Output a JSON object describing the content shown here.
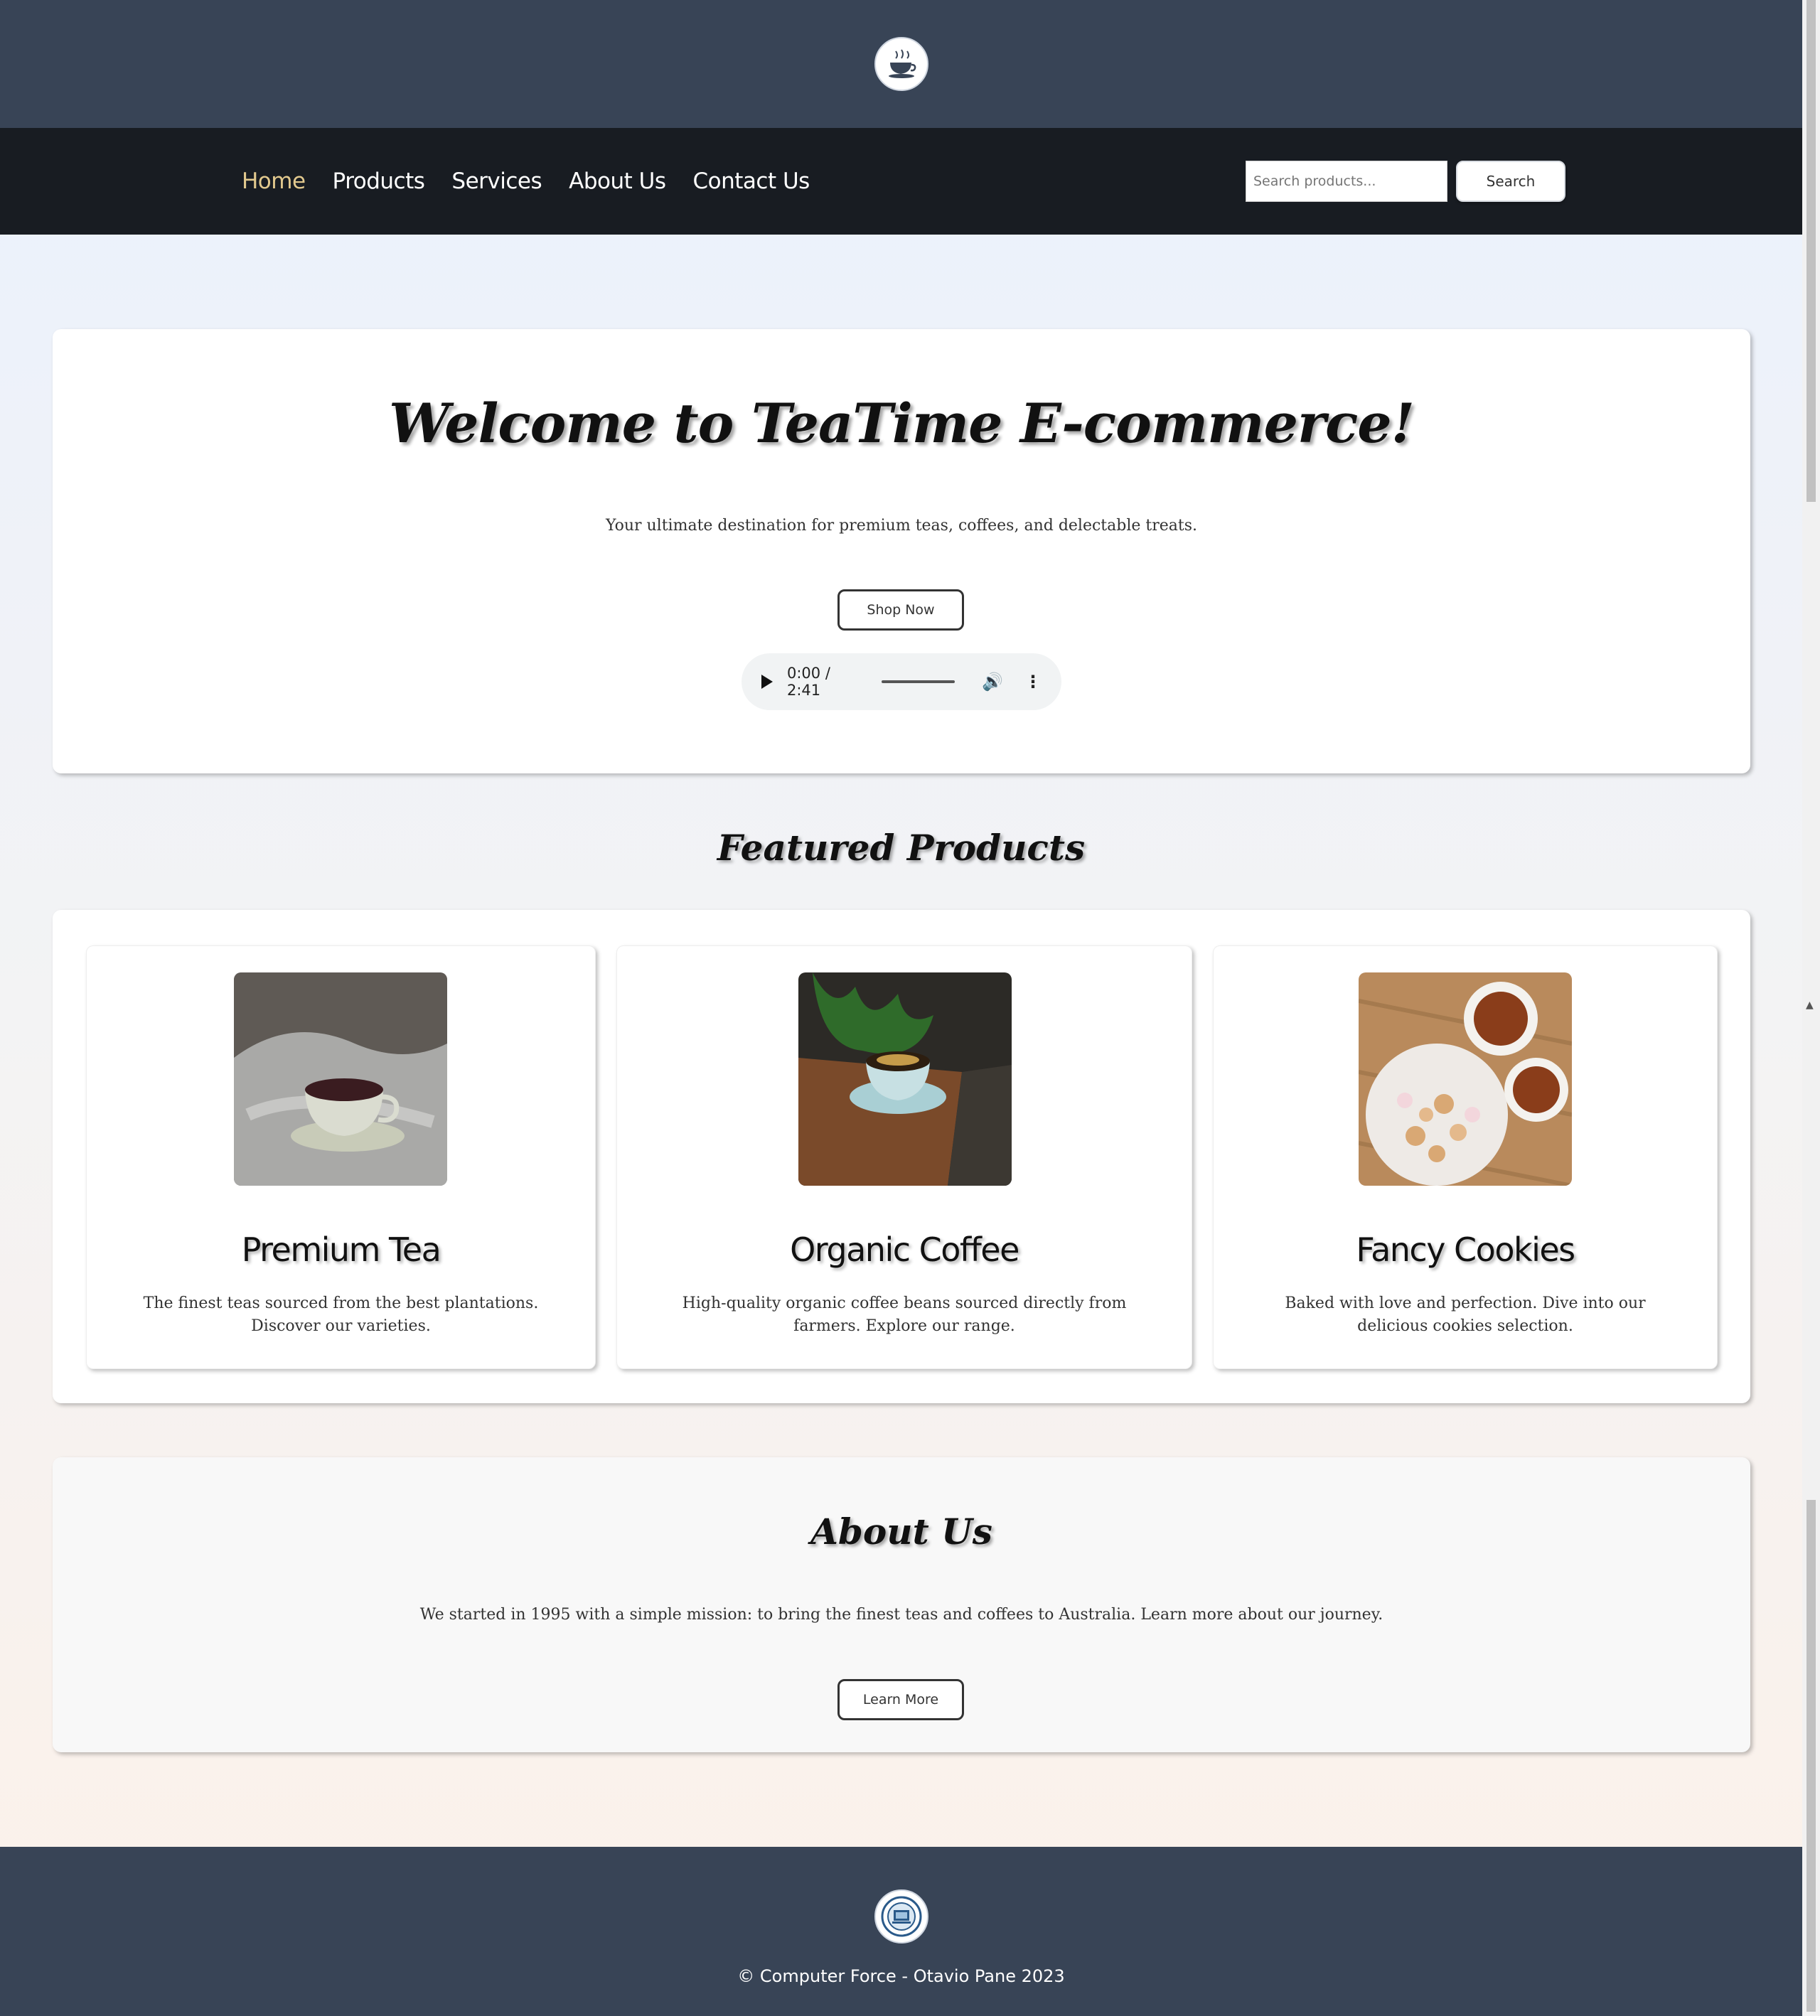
{
  "header": {
    "logo_icon": "teacup-logo-icon"
  },
  "nav": {
    "items": [
      {
        "label": "Home",
        "active": true
      },
      {
        "label": "Products",
        "active": false
      },
      {
        "label": "Services",
        "active": false
      },
      {
        "label": "About Us",
        "active": false
      },
      {
        "label": "Contact Us",
        "active": false
      }
    ],
    "search": {
      "placeholder": "Search products...",
      "button_label": "Search"
    }
  },
  "hero": {
    "title": "Welcome to TeaTime E-commerce!",
    "subtitle": "Your ultimate destination for premium teas, coffees, and delectable treats.",
    "cta_label": "Shop Now",
    "audio": {
      "time": "0:00 / 2:41"
    }
  },
  "featured": {
    "title": "Featured Products",
    "products": [
      {
        "name": "Premium Tea",
        "description": "The finest teas sourced from the best plantations. Discover our varieties."
      },
      {
        "name": "Organic Coffee",
        "description": "High-quality organic coffee beans sourced directly from farmers. Explore our range."
      },
      {
        "name": "Fancy Cookies",
        "description": "Baked with love and perfection. Dive into our delicious cookies selection."
      }
    ]
  },
  "about": {
    "title": "About Us",
    "text": "We started in 1995 with a simple mission: to bring the finest teas and coffees to Australia. Learn more about our journey.",
    "button_label": "Learn More"
  },
  "footer": {
    "logo_icon": "computer-force-logo-icon",
    "copyright": "© Computer Force - Otavio Pane 2023"
  },
  "colors": {
    "header_bg": "#384456",
    "nav_bg": "#181c22",
    "nav_active": "#e2c98e"
  }
}
